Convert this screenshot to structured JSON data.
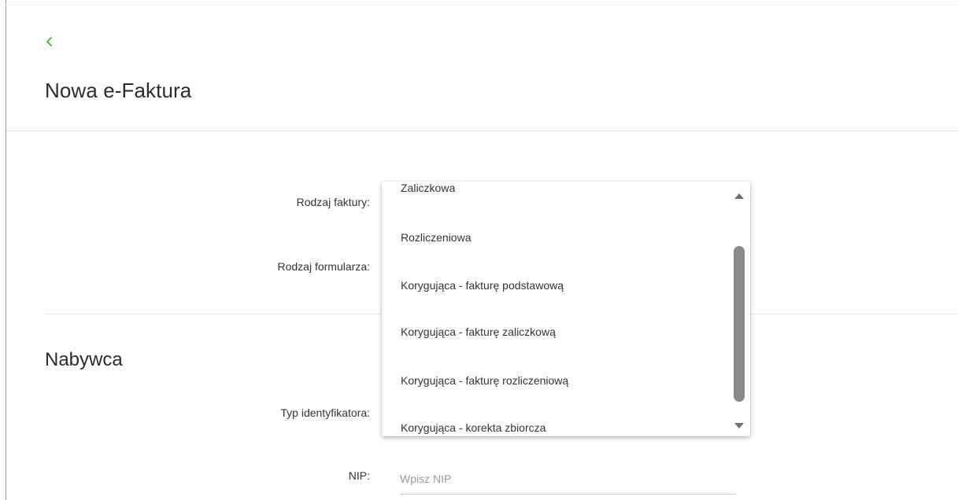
{
  "header": {
    "title": "Nowa e-Faktura"
  },
  "form": {
    "invoice_type_label": "Rodzaj faktury:",
    "form_type_label": "Rodzaj formularza:"
  },
  "buyer_section": {
    "title": "Nabywca",
    "identifier_type_label": "Typ identyfikatora:",
    "nip_label": "NIP:",
    "nip_placeholder": "Wpisz NIP",
    "nip_value": ""
  },
  "invoice_type_dropdown": {
    "options": [
      "Zaliczkowa",
      "Rozliczeniowa",
      "Korygująca - fakturę podstawową",
      "Korygująca - fakturę zaliczkową",
      "Korygująca - fakturę rozliczeniową",
      "Korygująca - korekta zbiorcza"
    ]
  },
  "colors": {
    "accent": "#4caf2e",
    "border_accent": "#7fb35a",
    "scrollbar": "#8a8a8a"
  },
  "icons": {
    "back": "chevron-left-icon",
    "scroll_up": "triangle-up-icon",
    "scroll_down": "triangle-down-icon"
  }
}
